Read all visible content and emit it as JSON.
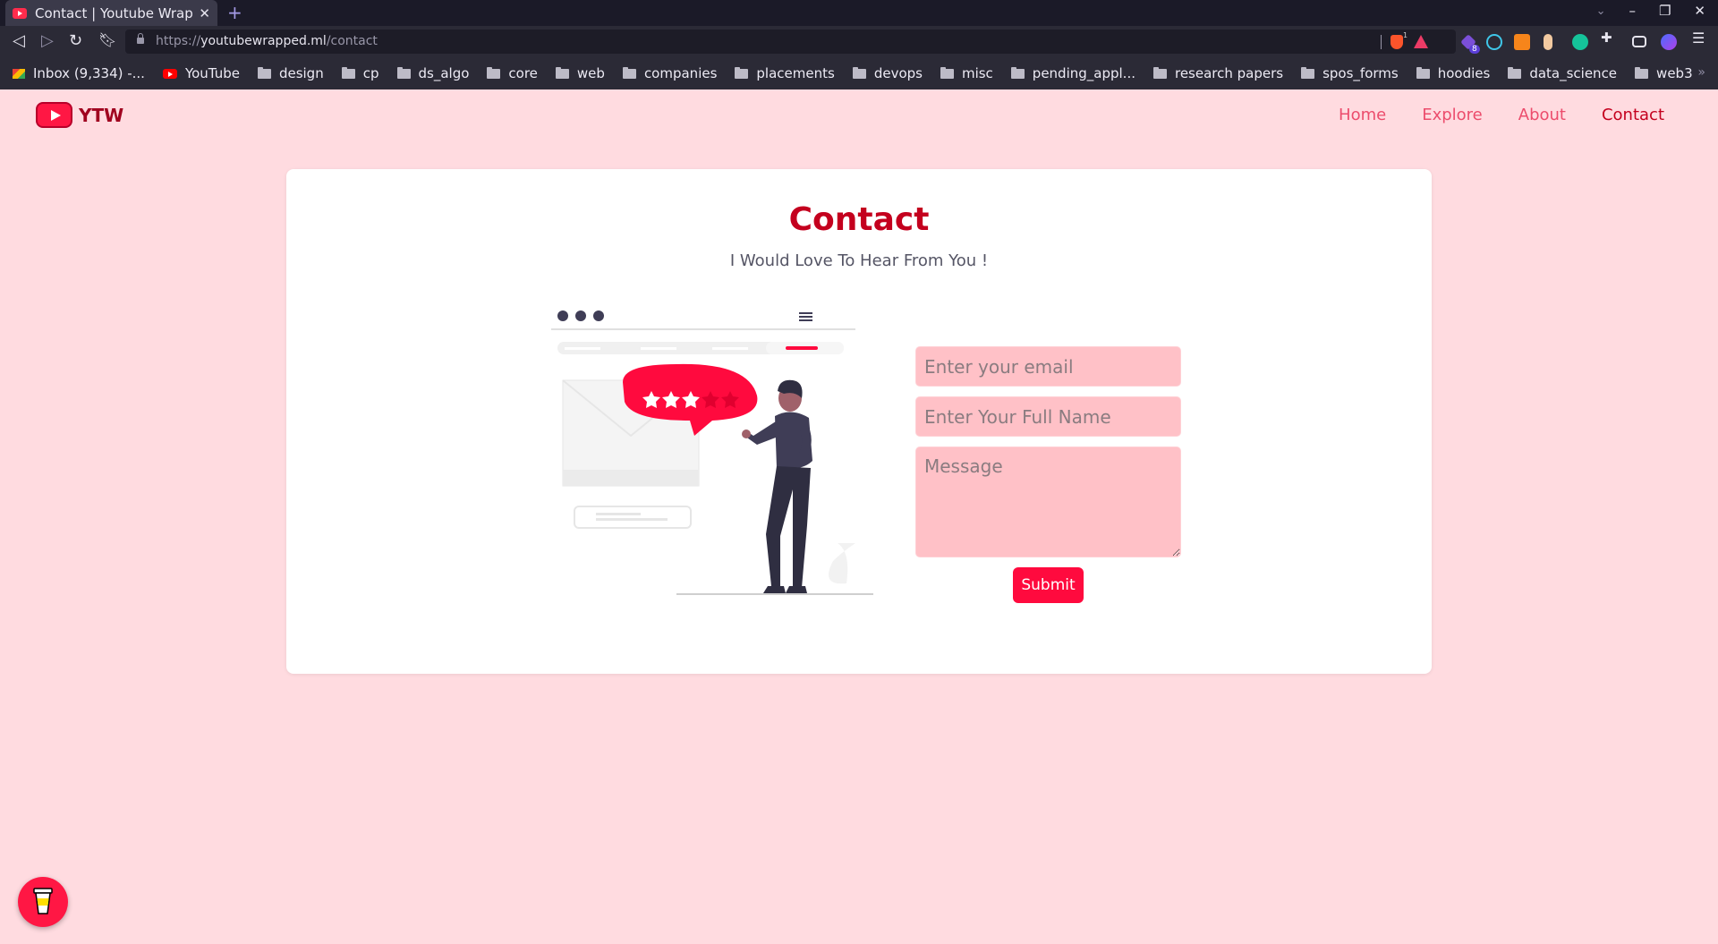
{
  "browser": {
    "tab_title": "Contact | Youtube Wrapped",
    "url_scheme": "https://",
    "url_host": "youtubewrapped.ml",
    "url_path": "/contact",
    "bookmarks": [
      {
        "label": "Inbox (9,334) -...",
        "icon": "gmail-icon"
      },
      {
        "label": "YouTube",
        "icon": "youtube-icon"
      },
      {
        "label": "design",
        "icon": "folder-icon"
      },
      {
        "label": "cp",
        "icon": "folder-icon"
      },
      {
        "label": "ds_algo",
        "icon": "folder-icon"
      },
      {
        "label": "core",
        "icon": "folder-icon"
      },
      {
        "label": "web",
        "icon": "folder-icon"
      },
      {
        "label": "companies",
        "icon": "folder-icon"
      },
      {
        "label": "placements",
        "icon": "folder-icon"
      },
      {
        "label": "devops",
        "icon": "folder-icon"
      },
      {
        "label": "misc",
        "icon": "folder-icon"
      },
      {
        "label": "pending_appl...",
        "icon": "folder-icon"
      },
      {
        "label": "research papers",
        "icon": "folder-icon"
      },
      {
        "label": "spos_forms",
        "icon": "folder-icon"
      },
      {
        "label": "hoodies",
        "icon": "folder-icon"
      },
      {
        "label": "data_science",
        "icon": "folder-icon"
      },
      {
        "label": "web3",
        "icon": "folder-icon"
      }
    ],
    "extension_badge": "8",
    "shield_badge": "1"
  },
  "site": {
    "logo_text": "YTW",
    "nav": {
      "home": "Home",
      "explore": "Explore",
      "about": "About",
      "contact": "Contact"
    }
  },
  "contact": {
    "title": "Contact",
    "subtitle": "I Would Love To Hear From You !",
    "email_placeholder": "Enter your email",
    "name_placeholder": "Enter Your Full Name",
    "message_placeholder": "Message",
    "submit_label": "Submit"
  },
  "colors": {
    "page_bg": "#ffdbe0",
    "accent": "#ff0a3e",
    "title": "#c4001e",
    "field_bg": "#ffc1c7"
  }
}
